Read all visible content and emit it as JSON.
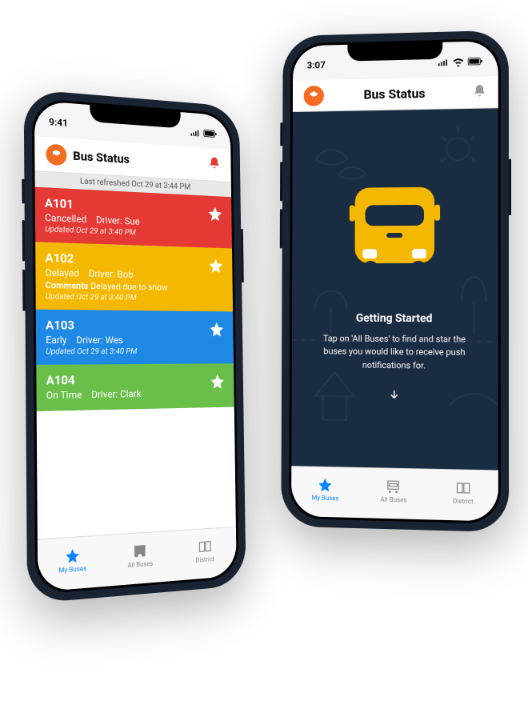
{
  "phone_left": {
    "status": {
      "time": "9:41"
    },
    "header": {
      "title": "Bus Status"
    },
    "refresh": "Last refreshed Oct 29 at 3:44 PM",
    "buses": [
      {
        "id": "A101",
        "status": "Cancelled",
        "driver_label": "Driver:",
        "driver": "Sue",
        "updated": "Updated Oct 29 at 3:40 PM",
        "color": "cancelled"
      },
      {
        "id": "A102",
        "status": "Delayed",
        "driver_label": "Driver:",
        "driver": "Bob",
        "comments_label": "Comments",
        "comments": "Delayed due to snow",
        "updated": "Updated Oct 29 at 3:40 PM",
        "color": "delayed"
      },
      {
        "id": "A103",
        "status": "Early",
        "driver_label": "Driver:",
        "driver": "Wes",
        "updated": "Updated Oct 29 at 3:40 PM",
        "color": "early"
      },
      {
        "id": "A104",
        "status": "On Time",
        "driver_label": "Driver:",
        "driver": "Clark",
        "color": "ontime"
      }
    ],
    "tabs": [
      {
        "label": "My Buses",
        "icon": "star",
        "active": true
      },
      {
        "label": "All Buses",
        "icon": "bus",
        "active": false
      },
      {
        "label": "District",
        "icon": "book",
        "active": false
      }
    ]
  },
  "phone_right": {
    "status": {
      "time": "3:07"
    },
    "header": {
      "title": "Bus Status"
    },
    "onboarding": {
      "title": "Getting Started",
      "text": "Tap on 'All Buses' to find and star the buses you would like to receive push notifications for."
    },
    "tabs": [
      {
        "label": "My Buses",
        "icon": "star",
        "active": true
      },
      {
        "label": "All Buses",
        "icon": "bus",
        "active": false
      },
      {
        "label": "District",
        "icon": "book",
        "active": false
      }
    ]
  },
  "colors": {
    "cancelled": "#e53935",
    "delayed": "#f5b800",
    "early": "#1e88e5",
    "ontime": "#6abf4b",
    "brand": "#f36c21",
    "accent": "#0a84ff",
    "dark_bg": "#1a2c42"
  }
}
